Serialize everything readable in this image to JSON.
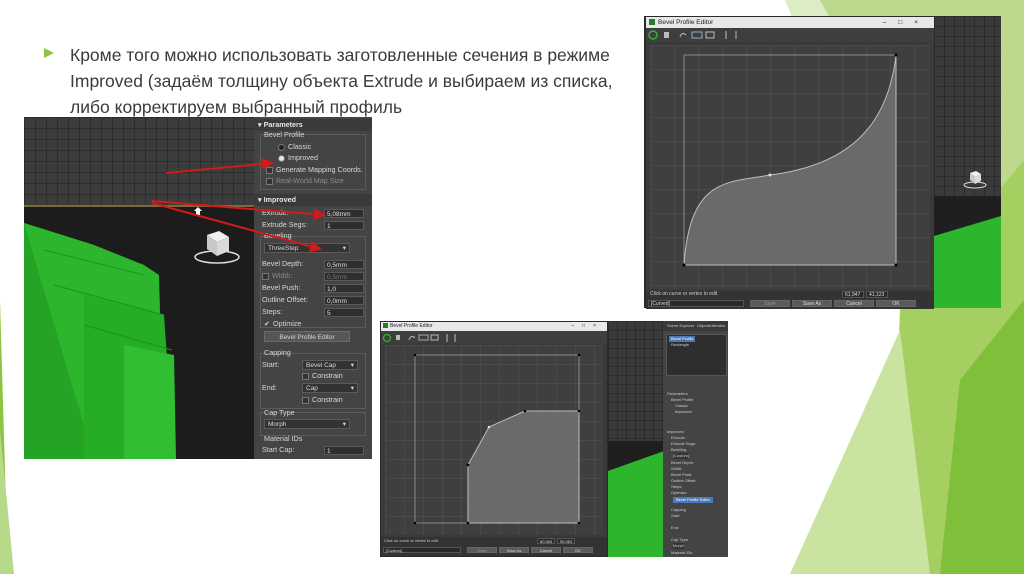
{
  "slide": {
    "text": "Кроме того можно использовать заготовленные сечения в режиме Improved (задаём толщину объекта Extrude и выбираем из списка, либо корректируем выбранный профиль"
  },
  "colors": {
    "accent_green": "#8cc63f",
    "light_green": "#c5e29a",
    "viewport_green": "#2db52d",
    "arrow_red": "#d11a1a",
    "panel_gray": "#444444"
  },
  "left_panel": {
    "parameters_title": "Parameters",
    "bevel_profile_label": "Bevel Profile",
    "classic_label": "Classic",
    "improved_label": "Improved",
    "gen_mapping_label": "Generate Mapping Coords.",
    "real_world_label": "Real-World Map Size",
    "improved_title": "Improved",
    "extrude_label": "Extrude:",
    "extrude_value": "5,08mm",
    "extrude_segs_label": "Extrude Segs:",
    "extrude_segs_value": "1",
    "beveling_label": "Beveling",
    "beveling_value": "ThreeStep",
    "bevel_depth_label": "Bevel Depth:",
    "bevel_depth_value": "0,5mm",
    "width_label": "Width:",
    "width_value": "0,5mm",
    "bevel_push_label": "Bevel Push:",
    "bevel_push_value": "1,0",
    "outline_offset_label": "Outline Offset:",
    "outline_offset_value": "0,0mm",
    "steps_label": "Steps:",
    "steps_value": "5",
    "optimize_label": "Optimize",
    "bevel_editor_button": "Bevel Profile Editor",
    "capping_label": "Capping",
    "start_label": "Start:",
    "start_value": "Bevel Cap",
    "constrain_label": "Constrain",
    "end_label": "End:",
    "end_value": "Cap",
    "cap_type_label": "Cap Type",
    "cap_type_value": "Morph",
    "material_ids_label": "Material IDs",
    "start_cap_label": "Start Cap:",
    "start_cap_value": "1"
  },
  "editor_top": {
    "title": "Bevel Profile Editor",
    "status_hint": "Click on curve or vertex to edit",
    "coord_x": "61,947",
    "coord_y": "41,123",
    "preset_value": "[Curved]",
    "save_label": "Save",
    "save_as_label": "Save As",
    "cancel_label": "Cancel",
    "ok_label": "OK"
  },
  "editor_bottom": {
    "title": "Bevel Profile Editor",
    "status_hint": "Click on curve or vertex to edit",
    "coord_x": "60,963",
    "coord_y": "55,963",
    "preset_value": "[Custom]",
    "save_label": "Save",
    "save_as_label": "Save As",
    "cancel_label": "Cancel",
    "ok_label": "OK"
  },
  "mini_panel": {
    "tab1": "Scene Explorer",
    "tab2": "Objects/Iterates",
    "item1": "Bevel Profile",
    "item2": "Rectangle",
    "parameters": "Parameters",
    "bevel_profile": "Bevel Profile",
    "classic": "Classic",
    "improved": "Improved",
    "improved_title": "Improved",
    "extrude": "Extrude:",
    "extrude_segs": "Extrude Segs:",
    "beveling": "Beveling",
    "custom": "[Custom]",
    "bevel_depth": "Bevel Depth:",
    "width": "Width:",
    "bevel_push": "Bevel Push:",
    "outline_offset": "Outline Offset:",
    "steps": "Steps:",
    "optimize": "Optimize",
    "editor_button": "Bevel Profile Editor",
    "capping": "Capping",
    "start": "Start:",
    "end": "End:",
    "cap_type": "Cap Type",
    "morph": "Morph",
    "material_ids": "Material IDs"
  }
}
